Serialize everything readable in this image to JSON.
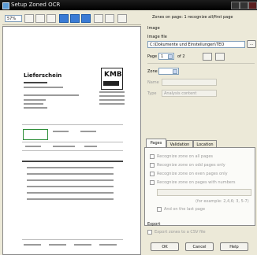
{
  "window": {
    "title": "Setup Zoned OCR"
  },
  "toolbar": {
    "zoom": "57%"
  },
  "preview": {
    "doc_title": "Lieferschein",
    "logo_text": "KMB"
  },
  "panel": {
    "zones_header": "Zones on page: 1 recognize all/first page",
    "image_section": "Image",
    "image_file_label": "Image file",
    "image_file_value": "C:\\Dokumente und Einstellungen\\TEO",
    "browse_label": "...",
    "page_label": "Page",
    "page_value": "1",
    "page_of": "of 2",
    "zone_label": "Zone",
    "name_label": "Name",
    "type_label": "Type",
    "type_value": "Analysis content",
    "tabs": [
      "Pages",
      "Validation",
      "Location"
    ],
    "options": [
      "Recognize zone on all pages",
      "Recognize zone on odd pages only",
      "Recognize zone on even pages only",
      "Recognize zone on pages with numbers"
    ],
    "example_text": "(for example: 2,4,6; 3, 5-7)",
    "last_page_label": "And on the last page",
    "export_section": "Export",
    "export_label": "Export zones to a CSV file",
    "ok_label": "OK",
    "cancel_label": "Cancel",
    "help_label": "Help"
  }
}
